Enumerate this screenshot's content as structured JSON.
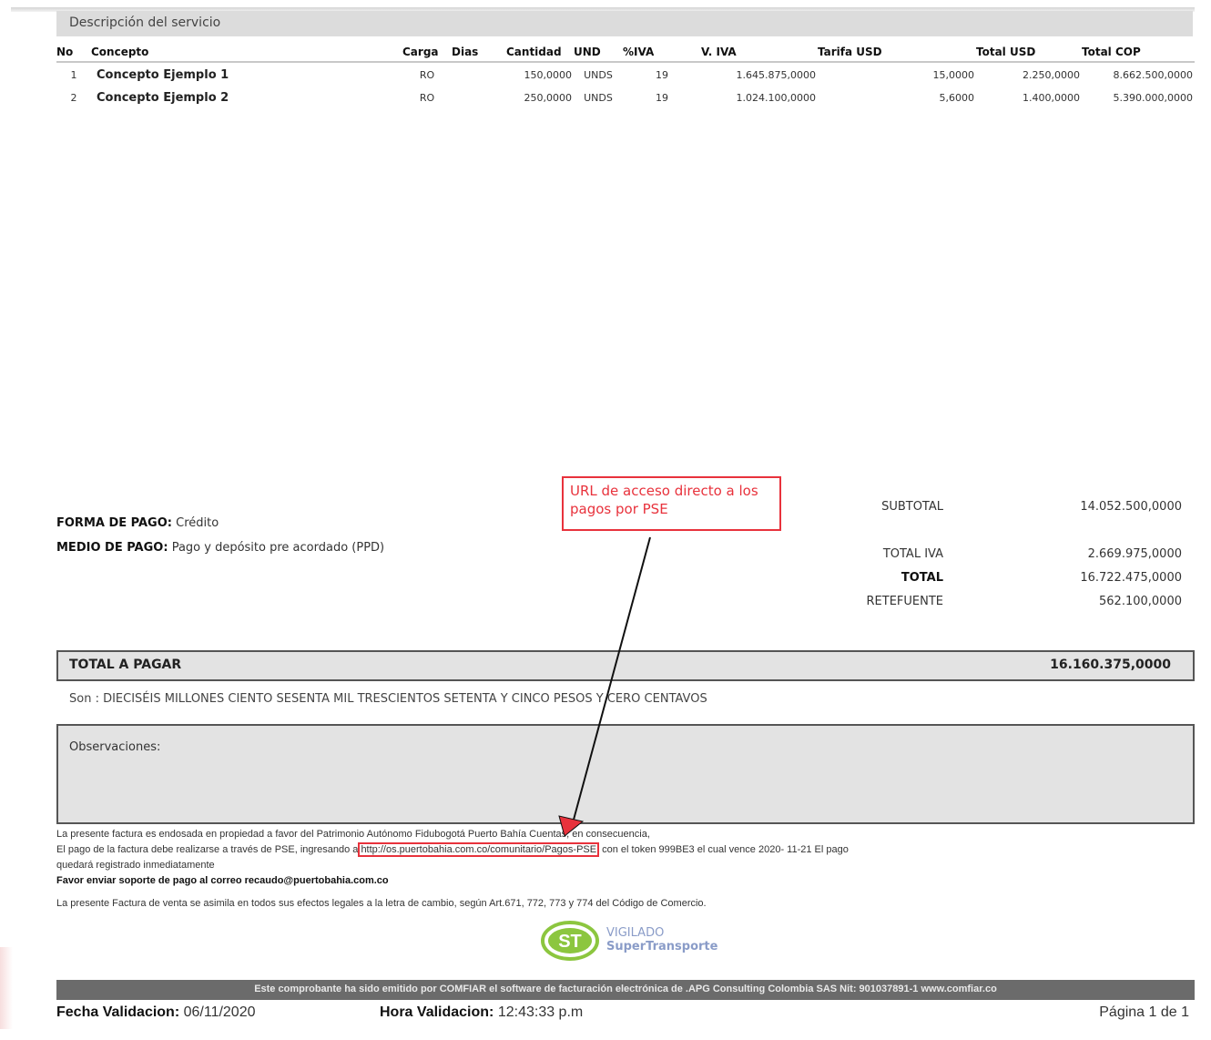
{
  "section_header": "Descripción del servicio",
  "table": {
    "headers": [
      "No",
      "Concepto",
      "Carga",
      "Dias",
      "Cantidad",
      "UND",
      "%IVA",
      "V. IVA",
      "Tarifa USD",
      "Total USD",
      "Total COP"
    ],
    "rows": [
      [
        "1",
        "Concepto Ejemplo 1",
        "RO",
        "",
        "150,0000",
        "UNDS",
        "19",
        "1.645.875,0000",
        "15,0000",
        "2.250,0000",
        "8.662.500,0000"
      ],
      [
        "2",
        "Concepto Ejemplo 2",
        "RO",
        "",
        "250,0000",
        "UNDS",
        "19",
        "1.024.100,0000",
        "5,6000",
        "1.400,0000",
        "5.390.000,0000"
      ]
    ]
  },
  "payment": {
    "forma_label": "FORMA DE PAGO:",
    "forma_value": "Crédito",
    "medio_label": "MEDIO DE PAGO:",
    "medio_value": "Pago y depósito pre acordado (PPD)"
  },
  "annotation": {
    "text": "URL de acceso directo a los pagos por PSE",
    "color": "#e8323c"
  },
  "totals": {
    "subtotal_label": "SUBTOTAL",
    "subtotal_value": "14.052.500,0000",
    "iva_label": "TOTAL IVA",
    "iva_value": "2.669.975,0000",
    "total_label": "TOTAL",
    "total_value": "16.722.475,0000",
    "retefuente_label": "RETEFUENTE",
    "retefuente_value": "562.100,0000"
  },
  "total_a_pagar": {
    "label": "TOTAL A PAGAR",
    "value": "16.160.375,0000"
  },
  "amount_words": "Son : DIECISÉIS MILLONES CIENTO SESENTA MIL TRESCIENTOS SETENTA Y CINCO PESOS Y CERO CENTAVOS",
  "observaciones_label": "Observaciones:",
  "notes": {
    "line1": "La presente factura es endosada en propiedad a favor del Patrimonio Autónomo Fidubogotá Puerto Bahía Cuentas, en consecuencia,",
    "line2_pre": "El pago de la factura debe realizarse a través de PSE, ingresando a",
    "url": "http://os.puertobahia.com.co/comunitario/Pagos-PSE",
    "line2_post": "con el token 999BE3 el cual vence 2020- 11-21 El pago",
    "line3": "quedará registrado inmediatamente",
    "line4": "Favor enviar soporte de pago al correo recaudo@puertobahia.com.co",
    "law": "La presente Factura de venta se asimila en todos sus efectos legales a la letra de cambio, según Art.671, 772, 773 y 774 del Código de Comercio."
  },
  "vigilado": {
    "logo_text": "ST",
    "line1": "VIGILADO",
    "line2": "SuperTransporte"
  },
  "footer_bar": "Este comprobante ha sido emitido por COMFIAR el software de facturación electrónica de .APG Consulting Colombia SAS Nit: 901037891-1 www.comfiar.co",
  "footer": {
    "fecha_label": "Fecha Validacion:",
    "fecha_value": "06/11/2020",
    "hora_label": "Hora Validacion:",
    "hora_value": "12:43:33 p.m",
    "pagina": "Página 1 de 1"
  }
}
